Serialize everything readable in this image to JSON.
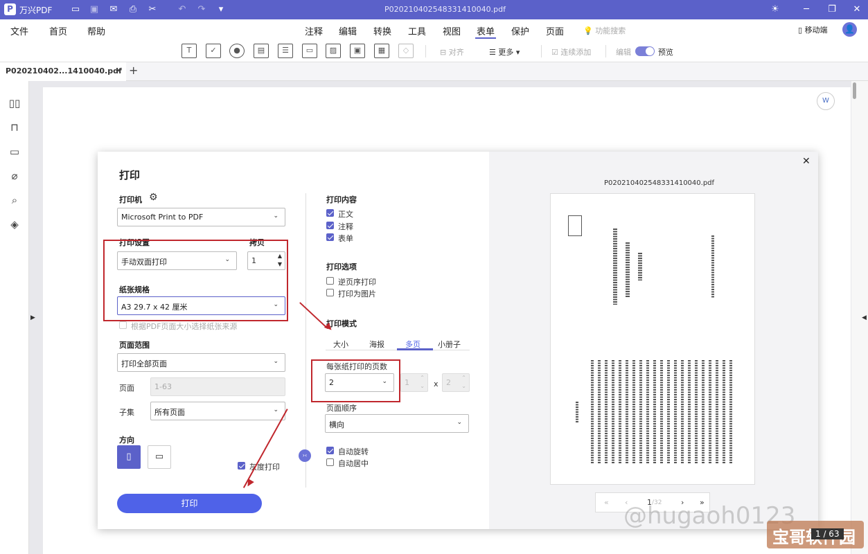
{
  "titlebar": {
    "logo": "P",
    "app_name": "万兴PDF",
    "doc_title": "P020210402548331410040.pdf"
  },
  "menubar": {
    "left": [
      "文件",
      "首页",
      "帮助"
    ],
    "center": [
      "注释",
      "编辑",
      "转换",
      "工具",
      "视图",
      "表单",
      "保护",
      "页面"
    ],
    "active": "表单",
    "search_placeholder": "功能搜索",
    "mobile": "移动端"
  },
  "toolbar": {
    "align_label": "对齐",
    "more_label": "更多",
    "continuous_add": "连续添加",
    "edit_label": "编辑",
    "preview_label": "预览"
  },
  "tab": {
    "name": "P020210402...1410040.pdf"
  },
  "dialog": {
    "title": "打印",
    "printer_label": "打印机",
    "printer_value": "Microsoft Print to PDF",
    "print_settings_label": "打印设置",
    "print_settings_value": "手动双面打印",
    "copies_label": "拷贝",
    "copies_value": "1",
    "paper_label": "纸张规格",
    "paper_value": "A3 29.7 x 42 厘米",
    "paper_source_label": "根据PDF页面大小选择纸张来源",
    "page_range_label": "页面范围",
    "page_range_value": "打印全部页面",
    "pages_label": "页面",
    "pages_value": "1-63",
    "subset_label": "子集",
    "subset_value": "所有页面",
    "orientation_label": "方向",
    "grayscale_label": "灰度打印",
    "print_button": "打印",
    "content_label": "打印内容",
    "content_items": [
      "正文",
      "注释",
      "表单"
    ],
    "options_label": "打印选项",
    "options_items": [
      "逆页序打印",
      "打印为图片"
    ],
    "mode_label": "打印模式",
    "mode_tabs": [
      "大小",
      "海报",
      "多页",
      "小册子"
    ],
    "active_mode": "多页",
    "pages_per_sheet_label": "每张纸打印的页数",
    "pages_per_sheet_value": "2",
    "grid_x": "1",
    "grid_times": "x",
    "grid_y": "2",
    "page_order_label": "页面顺序",
    "page_order_value": "横向",
    "auto_rotate_label": "自动旋转",
    "auto_center_label": "自动居中"
  },
  "preview": {
    "filename": "P020210402548331410040.pdf",
    "page_current": "1",
    "page_total": "/32",
    "first": "«",
    "prev": "‹",
    "next": "›",
    "last": "»"
  },
  "watermark": {
    "text": "@hugaoh0123",
    "badge": "宝哥软件园",
    "page_badge": "1 / 63"
  },
  "colors": {
    "accent": "#5b61c9",
    "primary_button": "#4f62e8",
    "annotation_red": "#c0272d"
  }
}
